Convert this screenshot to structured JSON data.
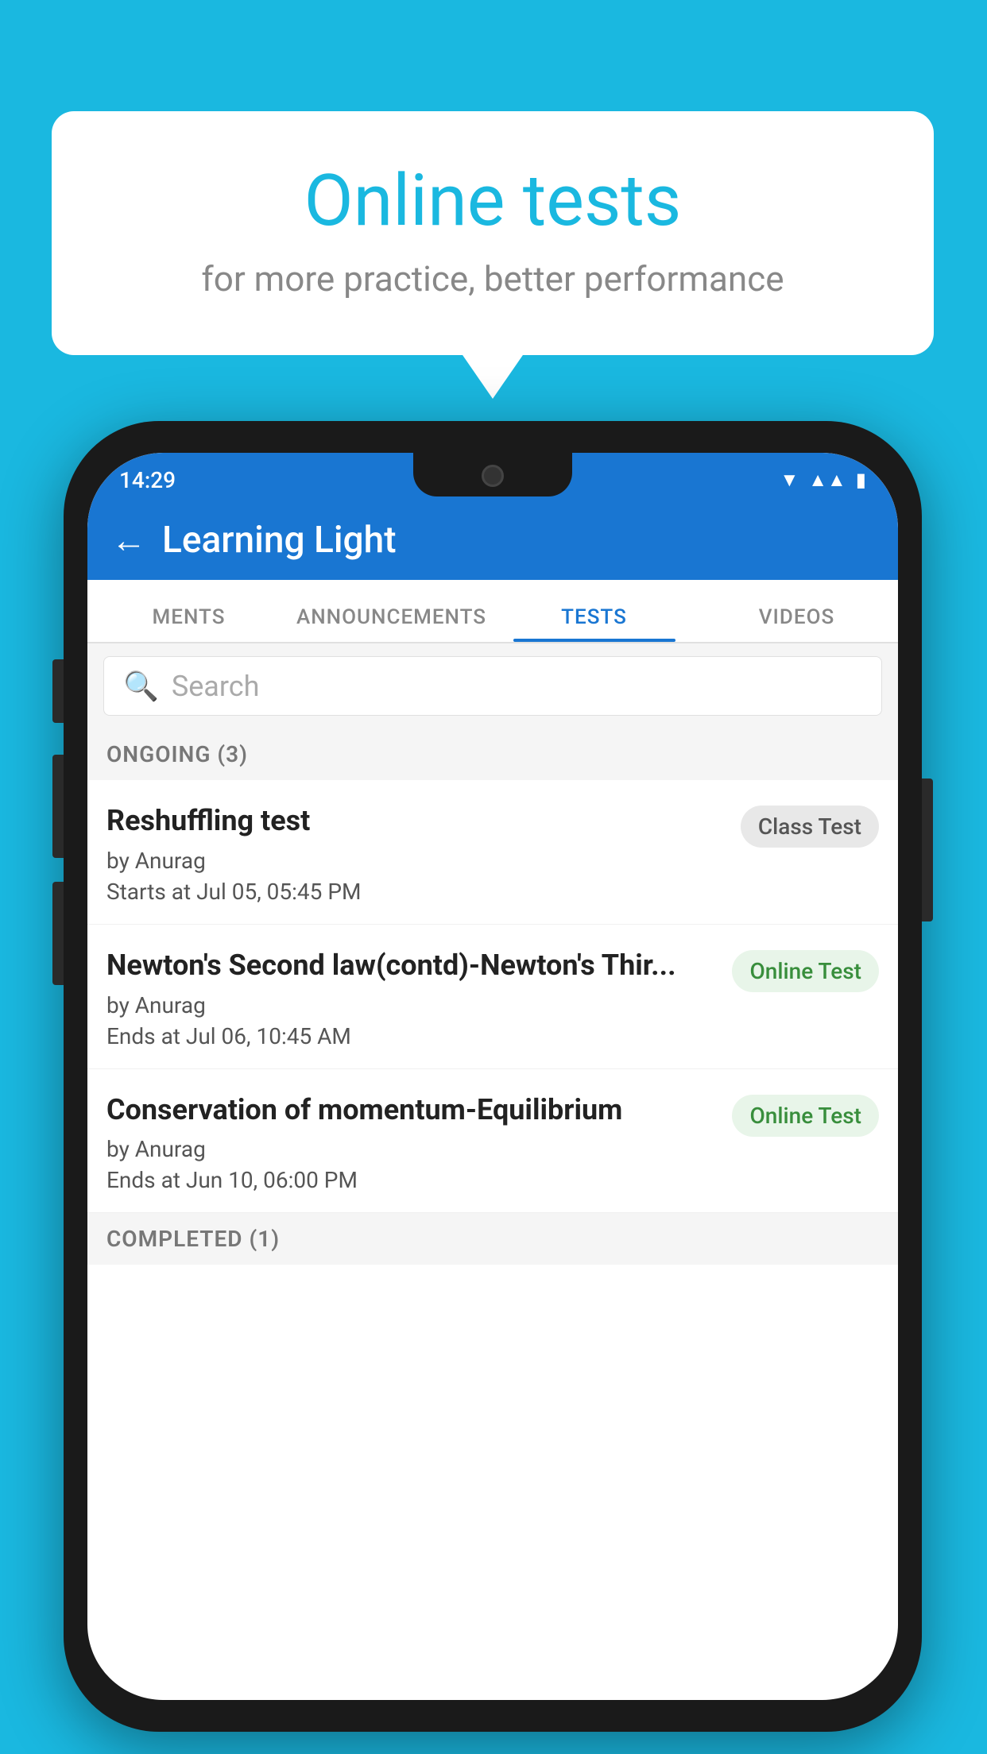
{
  "background_color": "#1ab8e0",
  "speech_bubble": {
    "title": "Online tests",
    "subtitle": "for more practice, better performance"
  },
  "phone": {
    "status_bar": {
      "time": "14:29",
      "icons": [
        "wifi",
        "signal",
        "battery"
      ]
    },
    "app_header": {
      "title": "Learning Light",
      "back_label": "←"
    },
    "tabs": [
      {
        "label": "MENTS",
        "active": false
      },
      {
        "label": "ANNOUNCEMENTS",
        "active": false
      },
      {
        "label": "TESTS",
        "active": true
      },
      {
        "label": "VIDEOS",
        "active": false
      }
    ],
    "search": {
      "placeholder": "Search"
    },
    "ongoing_section": {
      "label": "ONGOING (3)"
    },
    "test_items": [
      {
        "name": "Reshuffling test",
        "author": "by Anurag",
        "date_label": "Starts at  Jul 05, 05:45 PM",
        "badge": "Class Test",
        "badge_type": "class"
      },
      {
        "name": "Newton's Second law(contd)-Newton's Thir...",
        "author": "by Anurag",
        "date_label": "Ends at  Jul 06, 10:45 AM",
        "badge": "Online Test",
        "badge_type": "online"
      },
      {
        "name": "Conservation of momentum-Equilibrium",
        "author": "by Anurag",
        "date_label": "Ends at  Jun 10, 06:00 PM",
        "badge": "Online Test",
        "badge_type": "online"
      }
    ],
    "completed_section": {
      "label": "COMPLETED (1)"
    }
  }
}
